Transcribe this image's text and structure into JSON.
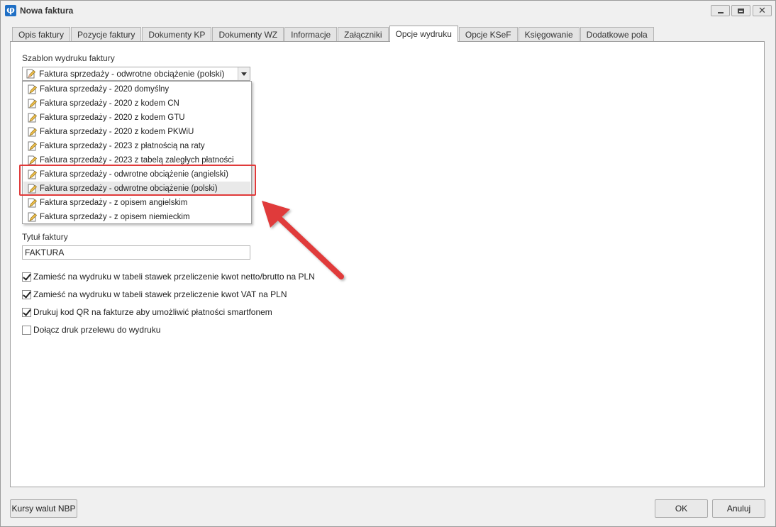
{
  "window": {
    "title": "Nowa faktura"
  },
  "tabs": [
    {
      "label": "Opis faktury"
    },
    {
      "label": "Pozycje faktury"
    },
    {
      "label": "Dokumenty KP"
    },
    {
      "label": "Dokumenty WZ"
    },
    {
      "label": "Informacje"
    },
    {
      "label": "Załączniki"
    },
    {
      "label": "Opcje wydruku",
      "active": true
    },
    {
      "label": "Opcje KSeF"
    },
    {
      "label": "Księgowanie"
    },
    {
      "label": "Dodatkowe pola"
    }
  ],
  "template": {
    "label": "Szablon wydruku faktury",
    "selected": "Faktura sprzedaży - odwrotne obciążenie (polski)",
    "options": [
      "Faktura sprzedaży - 2020 domyślny",
      "Faktura sprzedaży - 2020 z kodem CN",
      "Faktura sprzedaży - 2020 z kodem GTU",
      "Faktura sprzedaży - 2020 z kodem PKWiU",
      "Faktura sprzedaży - 2023 z płatnością na raty",
      "Faktura sprzedaży - 2023 z tabelą zaległych płatności",
      "Faktura sprzedaży - odwrotne obciążenie (angielski)",
      "Faktura sprzedaży - odwrotne obciążenie (polski)",
      "Faktura sprzedaży - z opisem angielskim",
      "Faktura sprzedaży - z opisem niemieckim"
    ]
  },
  "invoice_title": {
    "label": "Tytuł faktury",
    "value": "FAKTURA"
  },
  "checkboxes": [
    {
      "label": "Zamieść na wydruku w tabeli stawek przeliczenie kwot netto/brutto na PLN",
      "checked": true
    },
    {
      "label": "Zamieść na wydruku w tabeli stawek przeliczenie kwot VAT na PLN",
      "checked": true
    },
    {
      "label": "Drukuj kod QR na fakturze aby umożliwić płatności smartfonem",
      "checked": true
    },
    {
      "label": "Dołącz druk przelewu do wydruku",
      "checked": false
    }
  ],
  "buttons": {
    "rates": "Kursy walut NBP",
    "ok": "OK",
    "cancel": "Anuluj"
  },
  "colors": {
    "annotation": "#e03a3a",
    "app_icon": "#1f6fc5"
  }
}
